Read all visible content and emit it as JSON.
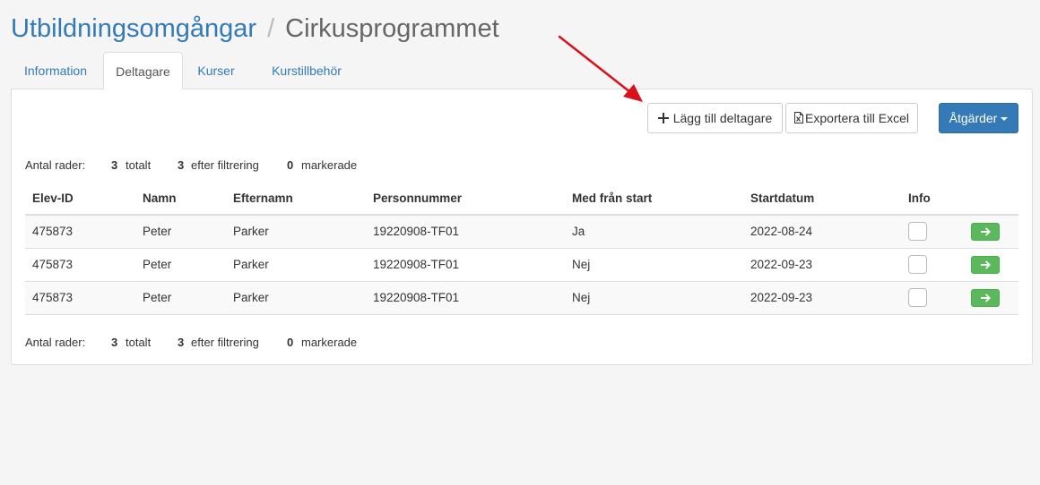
{
  "breadcrumb": {
    "parent": "Utbildningsomgångar",
    "separator": "/",
    "current": "Cirkusprogrammet"
  },
  "tabs": [
    {
      "label": "Information",
      "active": false
    },
    {
      "label": "Deltagare",
      "active": true
    },
    {
      "label": "Kurser",
      "active": false
    },
    {
      "label": "Kurstillbehör",
      "active": false
    }
  ],
  "toolbar": {
    "add_label": "Lägg till deltagare",
    "add_icon": "plus-icon",
    "export_label": "Exportera till Excel",
    "export_icon": "excel-file-icon",
    "actions_label": "Åtgärder"
  },
  "summary": {
    "label": "Antal rader:",
    "total_count": "3",
    "total_label": "totalt",
    "filtered_count": "3",
    "filtered_label": "efter filtrering",
    "selected_count": "0",
    "selected_label": "markerade"
  },
  "table": {
    "headers": [
      "Elev-ID",
      "Namn",
      "Efternamn",
      "Personnummer",
      "Med från start",
      "Startdatum",
      "Info"
    ],
    "rows": [
      {
        "elev_id": "475873",
        "namn": "Peter",
        "efternamn": "Parker",
        "personnummer": "19220908-TF01",
        "med_fran_start": "Ja",
        "startdatum": "2022-08-24",
        "checked": false
      },
      {
        "elev_id": "475873",
        "namn": "Peter",
        "efternamn": "Parker",
        "personnummer": "19220908-TF01",
        "med_fran_start": "Nej",
        "startdatum": "2022-09-23",
        "checked": false
      },
      {
        "elev_id": "475873",
        "namn": "Peter",
        "efternamn": "Parker",
        "personnummer": "19220908-TF01",
        "med_fran_start": "Nej",
        "startdatum": "2022-09-23",
        "checked": false
      }
    ]
  },
  "colors": {
    "link": "#337ab7",
    "primary": "#337ab7",
    "success": "#5cb85c",
    "annotation_arrow": "#d9111b"
  }
}
